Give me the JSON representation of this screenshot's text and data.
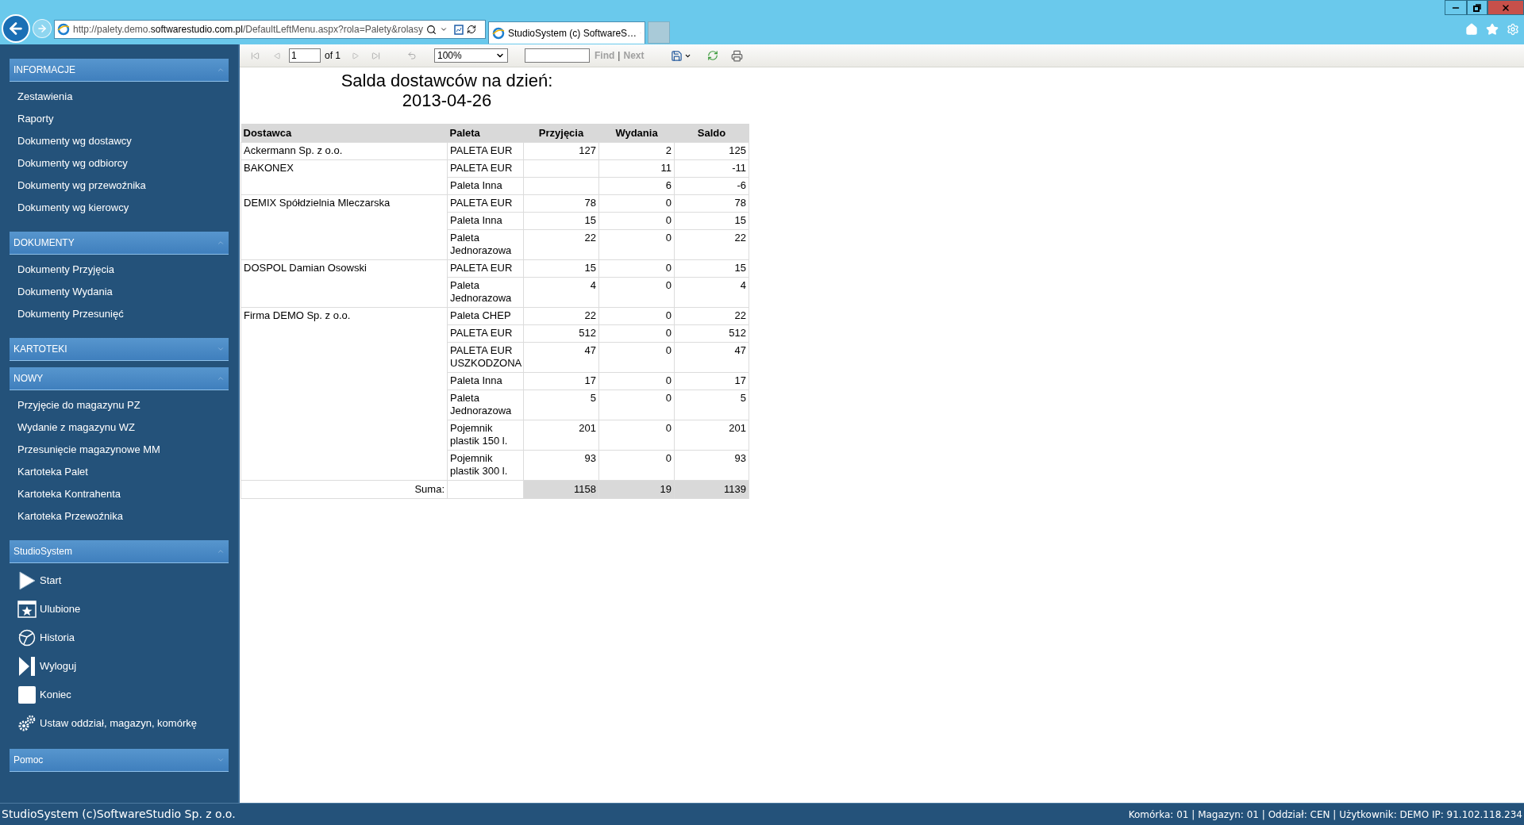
{
  "browser": {
    "address": "http://palety.demo.**softwarestudio.com.pl**/DefaultLeftMenu.aspx?rola=Palety&rolasy",
    "tabs": [
      {
        "title": "StudioSystem (c) SoftwareS…",
        "selected": true
      }
    ]
  },
  "sidebar": {
    "sections": [
      {
        "title": "INFORMACJE",
        "expanded": true,
        "items": [
          {
            "label": "Zestawienia"
          },
          {
            "label": "Raporty"
          },
          {
            "label": "Dokumenty wg dostawcy"
          },
          {
            "label": "Dokumenty wg odbiorcy"
          },
          {
            "label": "Dokumenty wg przewoźnika"
          },
          {
            "label": "Dokumenty wg kierowcy"
          }
        ]
      },
      {
        "title": "DOKUMENTY",
        "expanded": true,
        "items": [
          {
            "label": "Dokumenty Przyjęcia"
          },
          {
            "label": "Dokumenty Wydania"
          },
          {
            "label": "Dokumenty Przesunięć"
          }
        ]
      },
      {
        "title": "KARTOTEKI",
        "expanded": false
      },
      {
        "title": "NOWY",
        "expanded": true,
        "items": [
          {
            "label": "Przyjęcie do magazynu PZ"
          },
          {
            "label": "Wydanie z magazynu WZ"
          },
          {
            "label": "Przesunięcie magazynowe MM"
          },
          {
            "label": "Kartoteka Palet"
          },
          {
            "label": "Kartoteka Kontrahenta"
          },
          {
            "label": "Kartoteka Przewoźnika"
          }
        ]
      },
      {
        "title": "StudioSystem",
        "expanded": true,
        "kind": "icons",
        "items": [
          {
            "label": "Start"
          },
          {
            "label": "Ulubione"
          },
          {
            "label": "Historia"
          },
          {
            "label": "Wyloguj"
          },
          {
            "label": "Koniec"
          },
          {
            "label": "Ustaw oddział, magazyn, komórkę"
          }
        ]
      },
      {
        "title": "Pomoc",
        "expanded": false
      }
    ]
  },
  "report_toolbar": {
    "page": "1",
    "page_count": "of 1",
    "zoom": "100%",
    "find_label": "Find",
    "separator": "|",
    "next_label": "Next",
    "find_disabled": true
  },
  "report": {
    "title": [
      "Salda dostawców na dzień:",
      "2013-04-26"
    ],
    "columns": [
      "Dostawca",
      "Paleta",
      "Przyjęcia",
      "Wydania",
      "Saldo"
    ],
    "suppliers": [
      {
        "name": "Ackermann Sp. z o.o.",
        "rows": [
          {
            "paleta": "PALETA EUR",
            "przyjecia": "127",
            "wydania": "2",
            "saldo": "125"
          }
        ]
      },
      {
        "name": "BAKONEX",
        "rows": [
          {
            "paleta": "PALETA EUR",
            "wydania": "11",
            "saldo": "-11"
          },
          {
            "paleta": "Paleta Inna",
            "wydania": "6",
            "saldo": "-6"
          }
        ]
      },
      {
        "name": "DEMIX Spółdzielnia Mleczarska",
        "rows": [
          {
            "paleta": "PALETA EUR",
            "przyjecia": "78",
            "wydania": "0",
            "saldo": "78"
          },
          {
            "paleta": "Paleta Inna",
            "przyjecia": "15",
            "wydania": "0",
            "saldo": "15"
          },
          {
            "paleta": "Paleta Jednorazowa",
            "przyjecia": "22",
            "wydania": "0",
            "saldo": "22"
          }
        ]
      },
      {
        "name": "DOSPOL Damian Osowski",
        "rows": [
          {
            "paleta": "PALETA EUR",
            "przyjecia": "15",
            "wydania": "0",
            "saldo": "15"
          },
          {
            "paleta": "Paleta Jednorazowa",
            "przyjecia": "4",
            "wydania": "0",
            "saldo": "4"
          }
        ]
      },
      {
        "name": "Firma DEMO Sp. z o.o.",
        "rows": [
          {
            "paleta": "Paleta CHEP",
            "przyjecia": "22",
            "wydania": "0",
            "saldo": "22"
          },
          {
            "paleta": "PALETA EUR",
            "przyjecia": "512",
            "wydania": "0",
            "saldo": "512"
          },
          {
            "paleta": "PALETA EUR USZKODZONA",
            "przyjecia": "47",
            "wydania": "0",
            "saldo": "47"
          },
          {
            "paleta": "Paleta Inna",
            "przyjecia": "17",
            "wydania": "0",
            "saldo": "17"
          },
          {
            "paleta": "Paleta Jednorazowa",
            "przyjecia": "5",
            "wydania": "0",
            "saldo": "5"
          },
          {
            "paleta": "Pojemnik plastik 150 l.",
            "przyjecia": "201",
            "wydania": "0",
            "saldo": "201"
          },
          {
            "paleta": "Pojemnik plastik 300 l.",
            "przyjecia": "93",
            "wydania": "0",
            "saldo": "93"
          }
        ]
      }
    ],
    "total": {
      "label": "Suma:",
      "przyjecia": "1158",
      "wydania": "19",
      "saldo": "1139"
    }
  },
  "status_bar": {
    "left": "StudioSystem (c)SoftwareStudio Sp. z o.o.",
    "right": "Komórka: 01 | Magazyn: 01 | Oddział: CEN | Użytkownik: DEMO IP: 91.102.118.234"
  }
}
